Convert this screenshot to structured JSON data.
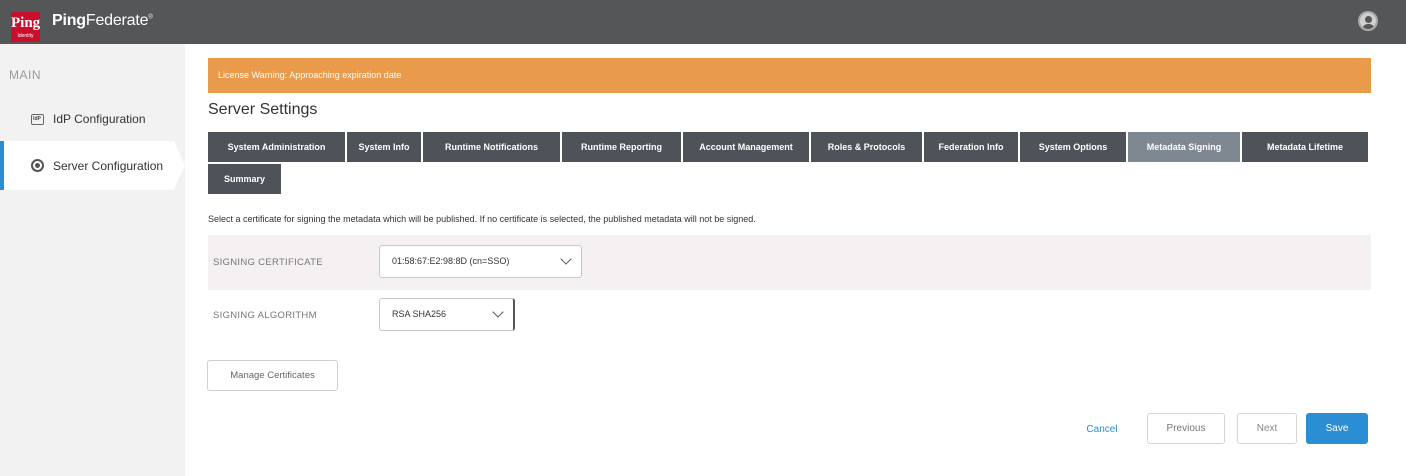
{
  "header": {
    "logo_text": "Ping",
    "logo_subtext": "Identity",
    "brand_bold": "Ping",
    "brand_light": "Federate",
    "user_icon": "user-avatar-icon"
  },
  "sidebar": {
    "section_label": "MAIN",
    "items": [
      {
        "label": "IdP Configuration",
        "icon": "idp-icon",
        "active": false
      },
      {
        "label": "Server Configuration",
        "icon": "server-config-icon",
        "active": true
      }
    ],
    "accent_color": "#2b8ed4"
  },
  "banner": {
    "text": "License Warning: Approaching expiration date",
    "color": "#e99a4a"
  },
  "page": {
    "title": "Server Settings",
    "instruction": "Select a certificate for signing the metadata which will be published. If no certificate is selected, the published metadata will not be signed."
  },
  "tabs": [
    {
      "label": "System Administration",
      "active": false
    },
    {
      "label": "System Info",
      "active": false
    },
    {
      "label": "Runtime Notifications",
      "active": false
    },
    {
      "label": "Runtime Reporting",
      "active": false
    },
    {
      "label": "Account Management",
      "active": false
    },
    {
      "label": "Roles & Protocols",
      "active": false
    },
    {
      "label": "Federation Info",
      "active": false
    },
    {
      "label": "System Options",
      "active": false
    },
    {
      "label": "Metadata Signing",
      "active": true
    },
    {
      "label": "Metadata Lifetime",
      "active": false
    },
    {
      "label": "Summary",
      "active": false
    }
  ],
  "form": {
    "signing_certificate": {
      "label": "SIGNING CERTIFICATE",
      "value": "01:58:67:E2:98:8D (cn=SSO)"
    },
    "signing_algorithm": {
      "label": "SIGNING ALGORITHM",
      "value": "RSA SHA256"
    }
  },
  "buttons": {
    "manage_certificates": "Manage Certificates",
    "cancel": "Cancel",
    "previous": "Previous",
    "next": "Next",
    "save": "Save"
  }
}
